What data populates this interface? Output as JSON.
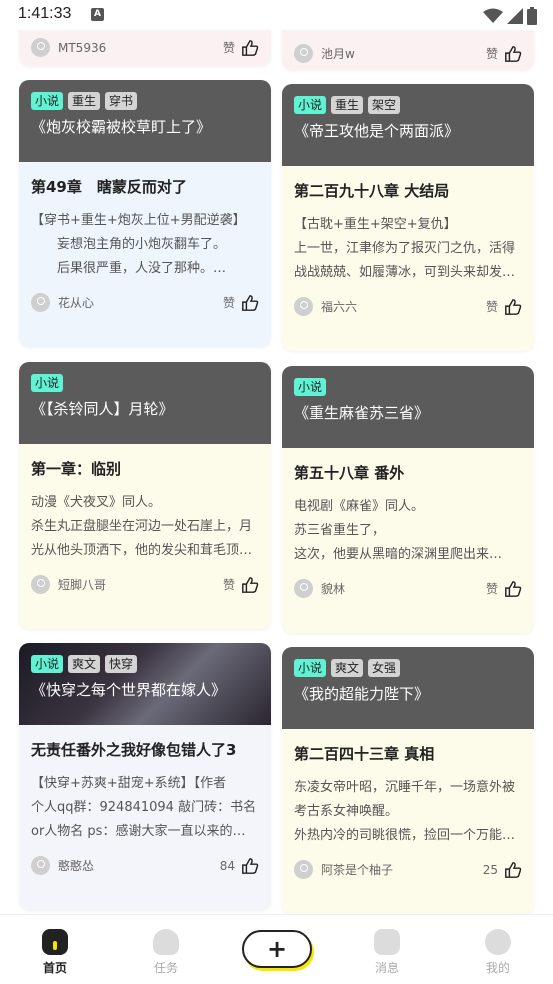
{
  "status": {
    "time": "1:41:33",
    "notif": "A"
  },
  "cards": [
    {
      "id": "top-left-stub",
      "author": "MT5936",
      "likes": "赞"
    },
    {
      "id": "top-right-stub",
      "author": "池月w",
      "likes": "赞"
    },
    {
      "tags": [
        "小说",
        "重生",
        "穿书"
      ],
      "title": "《炮灰校霸被校草盯上了》",
      "chapter": "第49章　瞎蒙反而对了",
      "excerpt": [
        "【穿书+重生+炮灰上位+男配逆袭】",
        "　　妄想泡主角的小炮灰翻车了。",
        "　　后果很严重，人没了那种。…"
      ],
      "author": "花从心",
      "likes": "赞"
    },
    {
      "tags": [
        "小说",
        "重生",
        "架空"
      ],
      "title": "《帝王攻他是个两面派》",
      "chapter": "第二百九十八章  大结局",
      "excerpt": [
        "【古耽+重生+架空+复仇】",
        "上一世，江聿修为了报灭门之仇，活得",
        "战战兢兢、如履薄冰，可到头来却发…"
      ],
      "author": "福六六",
      "likes": "赞"
    },
    {
      "tags": [
        "小说"
      ],
      "title": "《【杀铃同人】月轮》",
      "chapter": "第一章：临别",
      "excerpt": [
        "动漫《犬夜叉》同人。",
        "杀生丸正盘腿坐在河边一处石崖上，月",
        "光从他头顶洒下，他的发尖和茸毛顶…"
      ],
      "author": "短脚八哥",
      "likes": "赞"
    },
    {
      "tags": [
        "小说"
      ],
      "title": "《重生麻雀苏三省》",
      "chapter": "第五十八章 番外",
      "excerpt": [
        "电视剧《麻雀》同人。",
        "苏三省重生了，",
        "这次，他要从黑暗的深渊里爬出来…"
      ],
      "author": "貌林",
      "likes": "赞"
    },
    {
      "tags": [
        "小说",
        "爽文",
        "快穿"
      ],
      "title": "《快穿之每个世界都在嫁人》",
      "chapter": "无责任番外之我好像包错人了3",
      "excerpt": [
        "【快穿+苏爽+甜宠+系统】【作者",
        "个人qq群：924841094 敲门砖：书名",
        "or人物名 ps：感谢大家一直以来的…"
      ],
      "author": "憨憨怂",
      "likes": "84"
    },
    {
      "tags": [
        "小说",
        "爽文",
        "女强"
      ],
      "title": "《我的超能力陛下》",
      "chapter": "第二百四十三章 真相",
      "excerpt": [
        "东凌女帝叶昭，沉睡千年，一场意外被",
        "考古系女神唤醒。",
        "外热内冷的司眺很慌，捡回一个万能…"
      ],
      "author": "阿茶是个柚子",
      "likes": "25"
    }
  ],
  "tabs": [
    {
      "label": "首页",
      "icon": "home-icon"
    },
    {
      "label": "任务",
      "icon": "task-icon"
    },
    {
      "label": "+",
      "icon": "plus-icon"
    },
    {
      "label": "消息",
      "icon": "message-icon"
    },
    {
      "label": "我的",
      "icon": "profile-icon"
    }
  ]
}
